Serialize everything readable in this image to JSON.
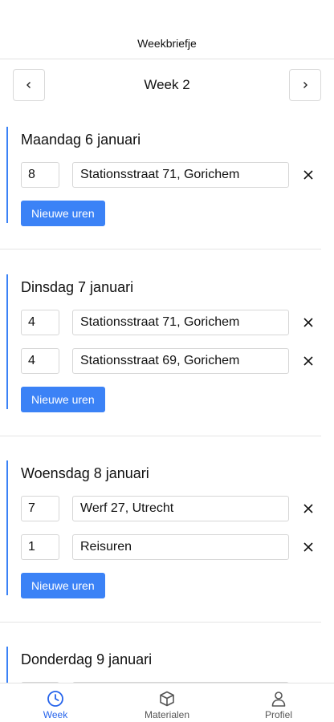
{
  "header": {
    "title": "Weekbriefje"
  },
  "week_nav": {
    "label": "Week 2",
    "prev_icon": "chevron-left-icon",
    "next_icon": "chevron-right-icon"
  },
  "days": [
    {
      "title": "Maandag 6 januari",
      "entries": [
        {
          "hours": "8",
          "location": "Stationsstraat 71, Gorichem"
        }
      ],
      "new_label": "Nieuwe uren"
    },
    {
      "title": "Dinsdag 7 januari",
      "entries": [
        {
          "hours": "4",
          "location": "Stationsstraat 71, Gorichem"
        },
        {
          "hours": "4",
          "location": "Stationsstraat 69, Gorichem"
        }
      ],
      "new_label": "Nieuwe uren"
    },
    {
      "title": "Woensdag 8 januari",
      "entries": [
        {
          "hours": "7",
          "location": "Werf 27, Utrecht"
        },
        {
          "hours": "1",
          "location": "Reisuren"
        }
      ],
      "new_label": "Nieuwe uren"
    },
    {
      "title": "Donderdag 9 januari",
      "entries": [],
      "new_label": ""
    }
  ],
  "tabs": [
    {
      "label": "Week",
      "icon": "clock-icon",
      "active": true
    },
    {
      "label": "Materialen",
      "icon": "box-icon",
      "active": false
    },
    {
      "label": "Profiel",
      "icon": "user-icon",
      "active": false
    }
  ],
  "colors": {
    "accent": "#3b82f6",
    "active_tab": "#2563eb"
  }
}
